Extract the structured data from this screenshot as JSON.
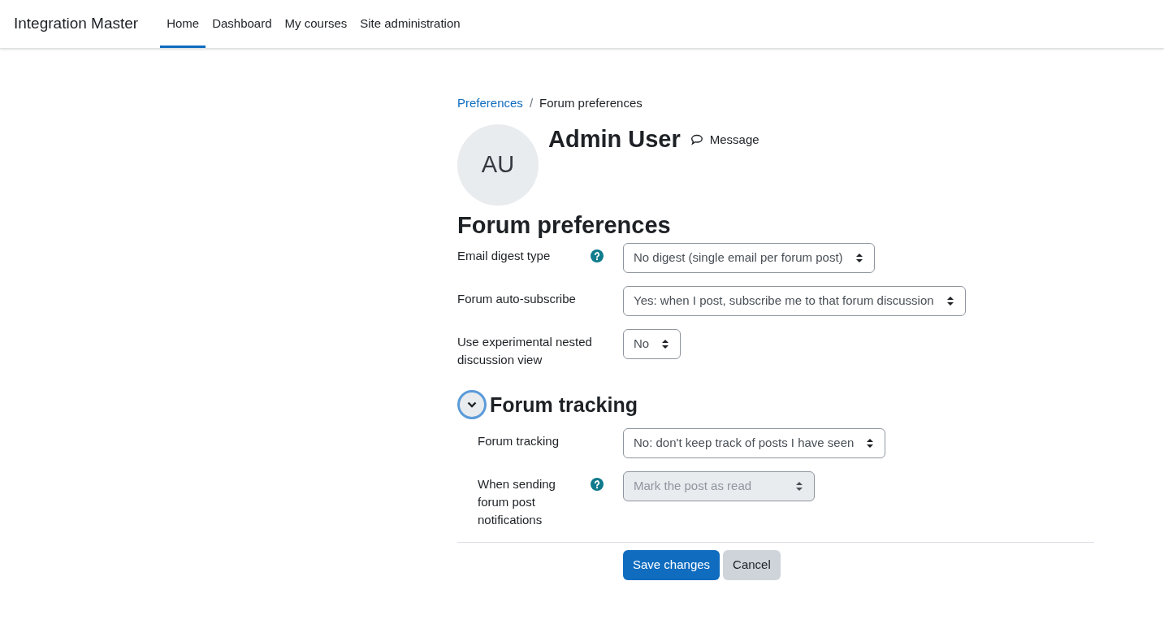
{
  "navbar": {
    "site_name": "Integration Master",
    "items": [
      {
        "label": "Home",
        "selected": true
      },
      {
        "label": "Dashboard",
        "selected": false
      },
      {
        "label": "My courses",
        "selected": false
      },
      {
        "label": "Site administration",
        "selected": false
      }
    ]
  },
  "breadcrumb_separator": "/",
  "breadcrumb": [
    {
      "label": "Preferences",
      "link": true
    },
    {
      "label": "Forum preferences",
      "link": false
    }
  ],
  "user": {
    "initials": "AU",
    "name": "Admin User",
    "message": "Message"
  },
  "heading": "Forum preferences",
  "fields": [
    {
      "label": "Email digest type",
      "help": true,
      "value": "No digest (single email per forum post)",
      "disabled": false
    },
    {
      "label": "Forum auto-subscribe",
      "help": false,
      "value": "Yes: when I post, subscribe me to that forum discussion",
      "disabled": false
    },
    {
      "label": "Use experimental nested discussion view",
      "help": false,
      "value": "No",
      "disabled": false
    }
  ],
  "tracking": {
    "title": "Forum tracking",
    "expanded": true,
    "fields": [
      {
        "label": "Forum tracking",
        "help": false,
        "value": "No: don't keep track of posts I have seen",
        "disabled": false
      },
      {
        "label": "When sending forum post notifications",
        "help": true,
        "value": "Mark the post as read",
        "disabled": true
      }
    ]
  },
  "buttons": [
    {
      "label": "Save changes",
      "kind": "primary"
    },
    {
      "label": "Cancel",
      "kind": "secondary"
    }
  ]
}
